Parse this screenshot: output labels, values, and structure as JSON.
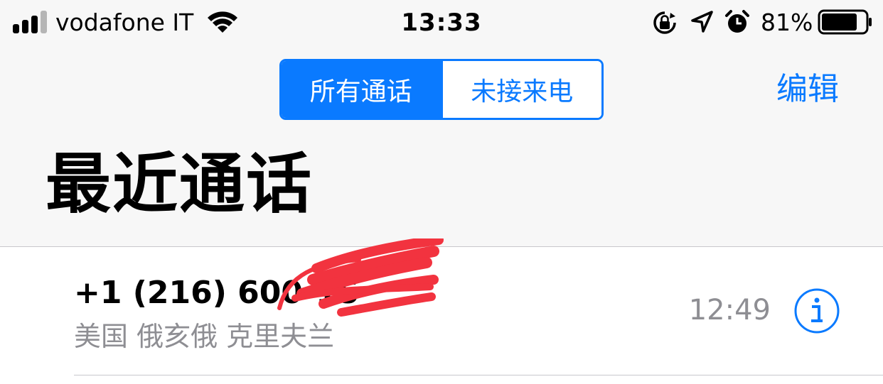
{
  "status_bar": {
    "carrier": "vodafone IT",
    "time": "13:33",
    "battery_percent": "81%",
    "signal_bars": 3,
    "signal_bars_total": 4,
    "battery_level": 0.81,
    "icons": [
      "signal-icon",
      "wifi-icon",
      "rotation-lock-icon",
      "location-arrow-icon",
      "alarm-icon",
      "battery-icon"
    ]
  },
  "nav": {
    "segments": [
      {
        "label": "所有通话",
        "selected": true
      },
      {
        "label": "未接来电",
        "selected": false
      }
    ],
    "edit_label": "编辑"
  },
  "title": "最近通话",
  "recents": [
    {
      "number": "+1 (216) 600-15",
      "number_redacted": true,
      "location": "美国 俄亥俄 克里夫兰",
      "time": "12:49",
      "info_icon": "info-icon"
    }
  ],
  "colors": {
    "accent": "#0a7aff",
    "background": "#f7f7f7",
    "secondary_text": "#8e8e93",
    "separator": "#c8c7cc",
    "redaction": "#f2333f"
  }
}
